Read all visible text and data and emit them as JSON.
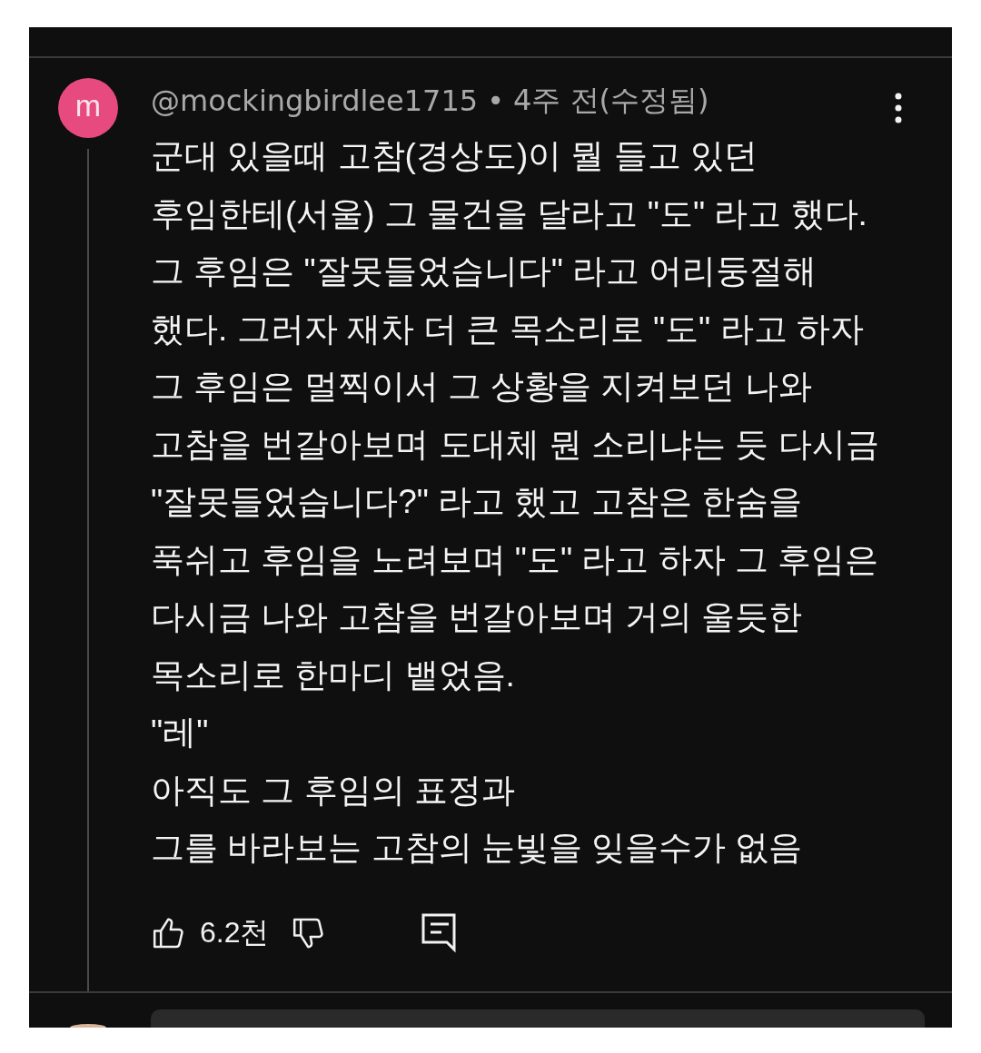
{
  "comment": {
    "avatar": {
      "letter": "m"
    },
    "author": "@mockingbirdlee1715",
    "separator": "•",
    "time": "4주 전(수정됨)",
    "text": "군대 있을때 고참(경상도)이 뭘 들고 있던\n후임한테(서울) 그 물건을 달라고 \"도\" 라고 했다.\n그 후임은 \"잘못들었습니다\" 라고 어리둥절해\n했다. 그러자 재차 더 큰 목소리로 \"도\" 라고 하자\n그 후임은 멀찍이서 그 상황을 지켜보던 나와\n고참을 번갈아보며 도대체 뭔 소리냐는 듯 다시금\n\"잘못들었습니다?\" 라고 했고 고참은 한숨을\n푹쉬고 후임을 노려보며 \"도\" 라고 하자 그 후임은\n다시금 나와 고참을 번갈아보며 거의 울듯한\n목소리로 한마디 뱉었음.\n\"레\"\n아직도 그 후임의 표정과\n그를 바라보는 고참의 눈빛을 잊을수가 없음",
    "likes": "6.2천"
  }
}
